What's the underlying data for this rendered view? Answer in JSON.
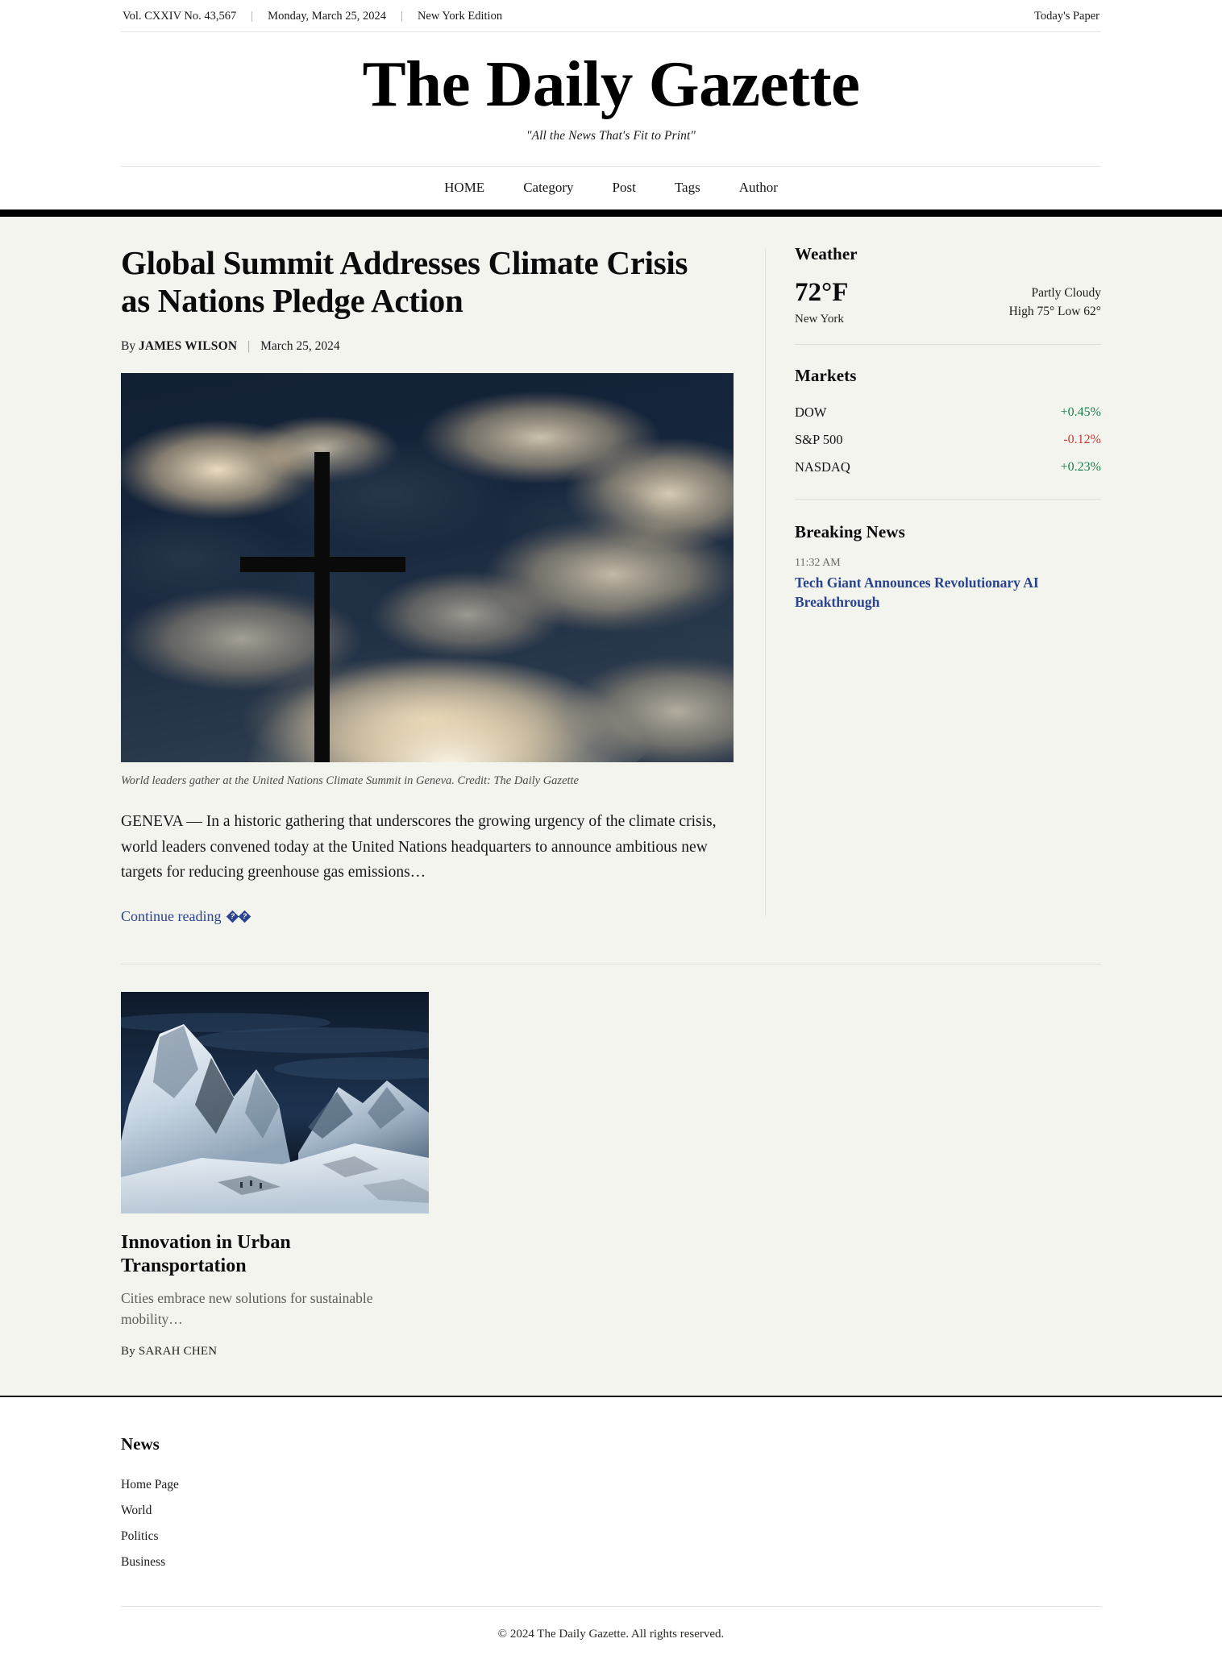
{
  "topbar": {
    "volume": "Vol. CXXIV No. 43,567",
    "date": "Monday, March 25, 2024",
    "edition": "New York Edition",
    "todays_paper": "Today's Paper",
    "separator": "|"
  },
  "masthead": {
    "title": "The Daily Gazette",
    "tagline": "\"All the News That's Fit to Print\""
  },
  "nav": {
    "items": [
      {
        "label": "HOME"
      },
      {
        "label": "Category"
      },
      {
        "label": "Post"
      },
      {
        "label": "Tags"
      },
      {
        "label": "Author"
      }
    ]
  },
  "lead_article": {
    "headline": "Global Summit Addresses Climate Crisis as Nations Pledge Action",
    "byline_prefix": "By",
    "author": "JAMES WILSON",
    "byline_separator": "|",
    "date": "March 25, 2024",
    "image_alt": "silhouetted-cross-against-dramatic-cloudy-sky",
    "caption": "World leaders gather at the United Nations Climate Summit in Geneva. Credit: The Daily Gazette",
    "body": "GENEVA — In a historic gathering that underscores the growing urgency of the climate crisis, world leaders convened today at the United Nations headquarters to announce ambitious new targets for reducing greenhouse gas emissions…",
    "continue_label": "Continue reading"
  },
  "sidebar": {
    "weather": {
      "title": "Weather",
      "temperature": "72°F",
      "city": "New York",
      "condition": "Partly Cloudy",
      "high_low": "High 75° Low 62°"
    },
    "markets": {
      "title": "Markets",
      "rows": [
        {
          "name": "DOW",
          "delta": "+0.45%",
          "direction": "up"
        },
        {
          "name": "S&P 500",
          "delta": "-0.12%",
          "direction": "down"
        },
        {
          "name": "NASDAQ",
          "delta": "+0.23%",
          "direction": "up"
        }
      ]
    },
    "breaking": {
      "title": "Breaking News",
      "items": [
        {
          "time": "11:32 AM",
          "headline": "Tech Giant Announces Revolutionary AI Breakthrough"
        }
      ]
    }
  },
  "secondary": {
    "cards": [
      {
        "image_alt": "snow-covered-mountain-range-under-dark-blue-sky",
        "title": "Innovation in Urban Transportation",
        "excerpt": "Cities embrace new solutions for sustainable mobility…",
        "byline": "By SARAH CHEN"
      }
    ]
  },
  "footer": {
    "columns": [
      {
        "title": "News",
        "links": [
          {
            "label": "Home Page"
          },
          {
            "label": "World"
          },
          {
            "label": "Politics"
          },
          {
            "label": "Business"
          }
        ]
      }
    ],
    "copyright": "© 2024 The Daily Gazette. All rights reserved."
  },
  "colors": {
    "link": "#29438f",
    "up": "#1a7f4e",
    "down": "#c23b3b",
    "body_bg": "#f4f4ef",
    "rule": "#000000"
  }
}
